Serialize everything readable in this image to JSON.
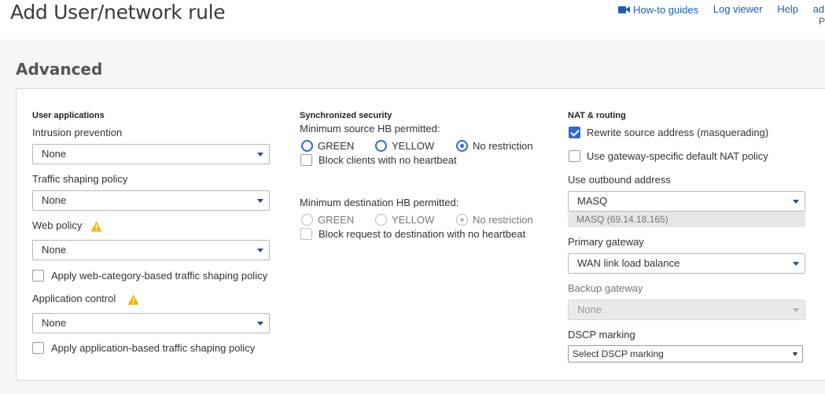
{
  "header": {
    "title": "Add User/network rule",
    "links": {
      "howto": "How-to guides",
      "logviewer": "Log viewer",
      "help": "Help",
      "admin": "adi"
    },
    "sub_letter": "P"
  },
  "section": {
    "title": "Advanced"
  },
  "user_apps": {
    "heading": "User applications",
    "ips_label": "Intrusion prevention",
    "ips_value": "None",
    "traffic_label": "Traffic shaping policy",
    "traffic_value": "None",
    "web_label": "Web policy",
    "web_value": "None",
    "web_cb_label": "Apply web-category-based traffic shaping policy",
    "app_label": "Application control",
    "app_value": "None",
    "app_cb_label": "Apply application-based traffic shaping policy"
  },
  "sync": {
    "heading": "Synchronized security",
    "src_label": "Minimum source HB permitted:",
    "src_options": [
      "GREEN",
      "YELLOW",
      "No restriction"
    ],
    "src_selected": "No restriction",
    "src_cb_label": "Block clients with no heartbeat",
    "dst_label": "Minimum destination HB permitted:",
    "dst_options": [
      "GREEN",
      "YELLOW",
      "No restriction"
    ],
    "dst_selected": "No restriction",
    "dst_cb_label": "Block request to destination with no heartbeat"
  },
  "nat": {
    "heading": "NAT & routing",
    "rewrite_label": "Rewrite source address (masquerading)",
    "rewrite_checked": true,
    "gw_nat_label": "Use gateway-specific default NAT policy",
    "gw_nat_checked": false,
    "outbound_label": "Use outbound address",
    "outbound_value": "MASQ",
    "outbound_sub": "MASQ (69.14.18.165)",
    "primary_label": "Primary gateway",
    "primary_value": "WAN link load balance",
    "backup_label": "Backup gateway",
    "backup_value": "None",
    "dscp_label": "DSCP marking",
    "dscp_value": "Select DSCP marking"
  },
  "icons": {
    "video": "video-camera-icon",
    "warning": "warning-triangle-icon",
    "caret": "chevron-down-icon"
  },
  "colors": {
    "accent": "#2a6ad1",
    "link": "#1a5fb4",
    "warning": "#f0b400"
  }
}
